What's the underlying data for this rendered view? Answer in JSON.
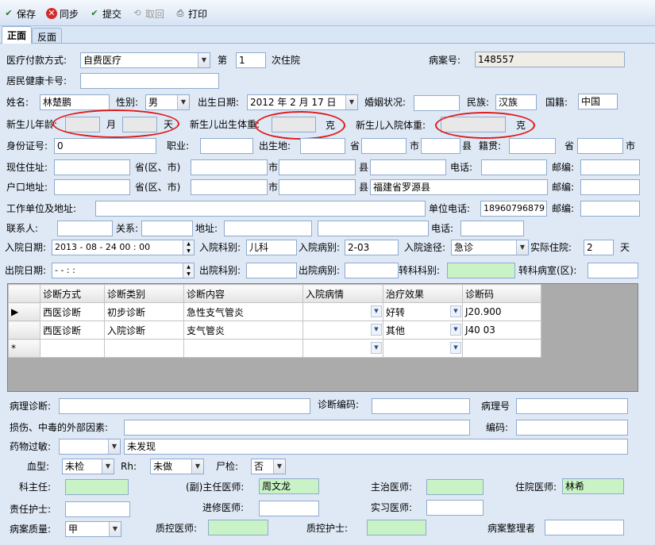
{
  "toolbar": {
    "save": "保存",
    "sync": "同步",
    "submit": "提交",
    "retrieve": "取回",
    "print": "打印"
  },
  "tabs": {
    "front": "正面",
    "back": "反面"
  },
  "labels": {
    "payment_method": "医疗付款方式:",
    "nth": "第",
    "admission_times": "次住院",
    "case_no": "病案号:",
    "health_card": "居民健康卡号:",
    "name": "姓名:",
    "sex": "性别:",
    "birthdate": "出生日期:",
    "marital": "婚姻状况:",
    "ethnicity": "民族:",
    "nationality": "国籍:",
    "newborn_age": "新生儿年龄:",
    "month": "月",
    "day": "天",
    "newborn_birth_weight": "新生儿出生体重:",
    "gram1": "克",
    "newborn_admit_weight": "新生儿入院体重:",
    "gram2": "克",
    "id_no": "身份证号:",
    "occupation": "职业:",
    "birthplace": "出生地:",
    "province": "省",
    "city": "市",
    "county": "县",
    "native_place": "籍贯:",
    "province2": "省",
    "city2": "市",
    "current_address": "现住住址:",
    "prov_district": "省(区、市)",
    "city3": "市",
    "county3": "县",
    "phone": "电话:",
    "postcode": "邮编:",
    "household_address": "户口地址:",
    "prov_district2": "省(区、市)",
    "city4": "市",
    "county4": "县",
    "postcode2": "邮编:",
    "work_address": "工作单位及地址:",
    "work_phone": "单位电话:",
    "postcode3": "邮编:",
    "contact": "联系人:",
    "relation": "关系:",
    "address": "地址:",
    "phone2": "电话:",
    "admit_date": "入院日期:",
    "admit_dept": "入院科别:",
    "admit_ward": "入院病别:",
    "admit_route": "入院途径:",
    "actual_days": "实际住院:",
    "days_unit": "天",
    "discharge_date": "出院日期:",
    "discharge_dept": "出院科别:",
    "discharge_ward": "出院病别:",
    "transfer_dept": "转科科别:",
    "transfer_room": "转科病室(区):",
    "pathology_dx": "病理诊断:",
    "dx_code": "诊断编码:",
    "pathology_no": "病理号",
    "injury_cause": "损伤、中毒的外部因素:",
    "code": "编码:",
    "drug_allergy": "药物过敏:",
    "blood_type": "血型:",
    "rh": "Rh:",
    "autopsy": "尸检:",
    "dept_director": "科主任:",
    "associate_chief": "(副)主任医师:",
    "attending": "主治医师:",
    "resident": "住院医师:",
    "nurse_in_charge": "责任护士:",
    "trainee": "进修医师:",
    "intern": "实习医师:",
    "record_quality": "病案质量:",
    "qc_doctor": "质控医师:",
    "qc_nurse": "质控护士:",
    "record_organizer": "病案整理者"
  },
  "values": {
    "payment_method": "自费医疗",
    "admission_times": "1",
    "case_no": "148557",
    "health_card": "",
    "name": "林楚鹏",
    "sex": "男",
    "birthdate": "2012 年 2 月 17 日",
    "marital": "",
    "ethnicity": "汉族",
    "nationality": "中国",
    "id_no": "0",
    "household_county": "福建省罗源县",
    "work_phone": "18960796879",
    "admit_date": "2013 - 08 - 24   00 : 00",
    "admit_dept": "儿科",
    "admit_ward": "2-03",
    "admit_route": "急诊",
    "actual_days": "2",
    "discharge_date": "  -    -         :     :",
    "drug_allergy_text": "未发现",
    "blood_type": "未检",
    "rh": "未做",
    "autopsy": "否",
    "associate_chief": "周文龙",
    "resident": "林希",
    "record_quality": "甲"
  },
  "grid": {
    "columns": [
      "诊断方式",
      "诊断类别",
      "诊断内容",
      "入院病情",
      "治疗效果",
      "诊断码"
    ],
    "rows": [
      {
        "marker": "▶",
        "cells": [
          "西医诊断",
          "初步诊断",
          "急性支气管炎",
          "",
          "好转",
          "J20.900"
        ]
      },
      {
        "marker": "",
        "cells": [
          "西医诊断",
          "入院诊断",
          "支气管炎",
          "",
          "其他",
          "J40   03"
        ]
      },
      {
        "marker": "*",
        "cells": [
          "",
          "",
          "",
          "",
          "",
          ""
        ]
      }
    ]
  },
  "colors": {
    "annotation_ring": "#e01a1a",
    "required_field": "#c9f3c6",
    "panel_bg": "#dfe9f6"
  },
  "icons": {
    "save": "check-icon",
    "sync": "no-icon",
    "submit": "check-icon",
    "retrieve": "retrieve-icon",
    "print": "printer-icon"
  }
}
